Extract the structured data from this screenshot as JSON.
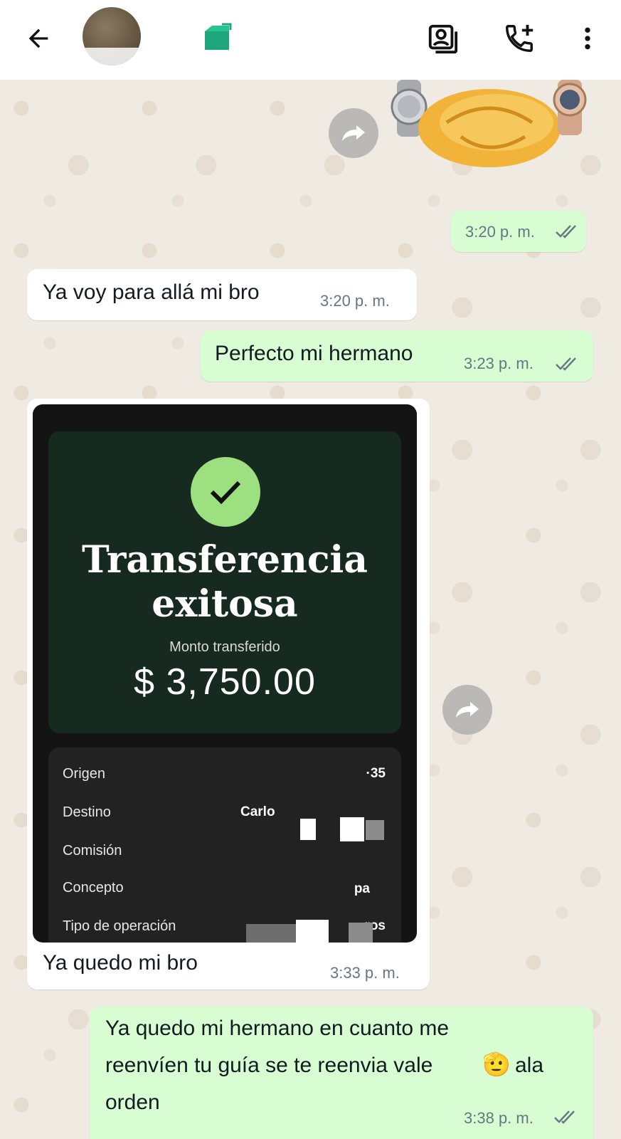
{
  "header": {
    "back_icon": "arrow-left-icon",
    "contact_icon": "green-app-icon",
    "actions": [
      "contact-card-icon",
      "add-call-icon",
      "more-vertical-icon"
    ]
  },
  "messages": [
    {
      "type": "sticker",
      "direction": "out",
      "time": "3:20 p. m.",
      "status": "read"
    },
    {
      "type": "text",
      "direction": "in",
      "text": "Ya voy para allá mi bro",
      "time": "3:20 p. m."
    },
    {
      "type": "text",
      "direction": "out",
      "text": "Perfecto mi hermano",
      "time": "3:23 p. m.",
      "status": "read"
    },
    {
      "type": "image",
      "direction": "in",
      "caption": "Ya quedo mi bro",
      "time": "3:33 p. m.",
      "receipt": {
        "title_line1": "Transferencia",
        "title_line2": "exitosa",
        "subtitle": "Monto transferido",
        "amount": "$ 3,750.00",
        "rows": [
          {
            "label": "Origen",
            "value": "·35"
          },
          {
            "label": "Destino",
            "value": "Carlo"
          },
          {
            "label": "Comisión",
            "value": ""
          },
          {
            "label": "Concepto",
            "value": "pa"
          },
          {
            "label": "Tipo de operación",
            "value": "ros"
          }
        ]
      }
    },
    {
      "type": "text",
      "direction": "out",
      "lines": [
        "Ya quedo mi hermano en cuanto me",
        "reenvíen tu guía se te reenvia vale",
        "orden"
      ],
      "emoji_inline": "🫡",
      "after_emoji": "ala",
      "time": "3:38 p. m.",
      "status": "read"
    }
  ],
  "colors": {
    "chat_bg": "#efeae2",
    "incoming_bubble": "#ffffff",
    "outgoing_bubble": "#d9fdd3",
    "read_ticks": "#667781",
    "success_green": "#9de07f"
  }
}
